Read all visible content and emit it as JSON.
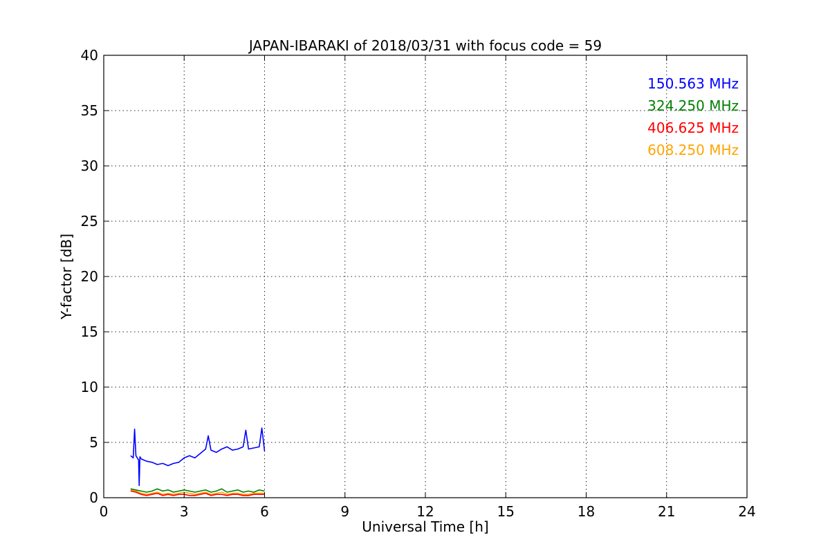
{
  "chart_data": {
    "type": "line",
    "title": "JAPAN-IBARAKI of 2018/03/31 with focus code = 59",
    "xlabel": "Universal Time [h]",
    "ylabel": "Y-factor [dB]",
    "xlim": [
      0,
      24
    ],
    "ylim": [
      0,
      40
    ],
    "xticks": [
      "0",
      "3",
      "6",
      "9",
      "12",
      "15",
      "18",
      "21",
      "24"
    ],
    "yticks": [
      "0",
      "5",
      "10",
      "15",
      "20",
      "25",
      "30",
      "35",
      "40"
    ],
    "grid": true,
    "legend_position": "top-right",
    "series": [
      {
        "name": "150.563 MHz",
        "color": "#0000ff",
        "x": [
          1.0,
          1.1,
          1.15,
          1.2,
          1.3,
          1.32,
          1.35,
          1.4,
          1.6,
          1.8,
          2.0,
          2.2,
          2.4,
          2.6,
          2.8,
          3.0,
          3.2,
          3.4,
          3.6,
          3.8,
          3.9,
          4.0,
          4.2,
          4.4,
          4.6,
          4.8,
          5.0,
          5.2,
          5.3,
          5.4,
          5.6,
          5.8,
          5.9,
          6.0
        ],
        "values": [
          3.8,
          3.6,
          6.2,
          3.8,
          3.4,
          1.1,
          3.7,
          3.5,
          3.3,
          3.2,
          3.0,
          3.1,
          2.9,
          3.1,
          3.2,
          3.6,
          3.8,
          3.6,
          4.0,
          4.4,
          5.6,
          4.3,
          4.1,
          4.4,
          4.6,
          4.3,
          4.4,
          4.6,
          6.1,
          4.4,
          4.5,
          4.6,
          6.3,
          4.2
        ]
      },
      {
        "name": "324.250 MHz",
        "color": "#008000",
        "x": [
          1.0,
          1.2,
          1.4,
          1.6,
          1.8,
          2.0,
          2.2,
          2.4,
          2.6,
          2.8,
          3.0,
          3.2,
          3.4,
          3.6,
          3.8,
          4.0,
          4.2,
          4.4,
          4.6,
          4.8,
          5.0,
          5.2,
          5.4,
          5.6,
          5.8,
          6.0
        ],
        "values": [
          0.8,
          0.7,
          0.6,
          0.5,
          0.6,
          0.8,
          0.6,
          0.7,
          0.5,
          0.6,
          0.7,
          0.6,
          0.5,
          0.6,
          0.7,
          0.5,
          0.6,
          0.8,
          0.5,
          0.6,
          0.7,
          0.5,
          0.6,
          0.5,
          0.7,
          0.6
        ]
      },
      {
        "name": "406.625 MHz",
        "color": "#ff0000",
        "x": [
          1.0,
          1.2,
          1.4,
          1.6,
          1.8,
          2.0,
          2.2,
          2.4,
          2.6,
          2.8,
          3.0,
          3.2,
          3.4,
          3.6,
          3.8,
          4.0,
          4.2,
          4.4,
          4.6,
          4.8,
          5.0,
          5.2,
          5.4,
          5.6,
          5.8,
          6.0
        ],
        "values": [
          0.6,
          0.5,
          0.3,
          0.2,
          0.3,
          0.4,
          0.2,
          0.3,
          0.2,
          0.3,
          0.3,
          0.2,
          0.2,
          0.3,
          0.4,
          0.2,
          0.3,
          0.3,
          0.2,
          0.3,
          0.3,
          0.2,
          0.2,
          0.3,
          0.3,
          0.3
        ]
      },
      {
        "name": "608.250 MHz",
        "color": "#ffa500",
        "x": [
          1.0,
          1.2,
          1.4,
          1.6,
          1.8,
          2.0,
          2.2,
          2.4,
          2.6,
          2.8,
          3.0,
          3.2,
          3.4,
          3.6,
          3.8,
          4.0,
          4.2,
          4.4,
          4.6,
          4.8,
          5.0,
          5.2,
          5.4,
          5.6,
          5.8,
          6.0
        ],
        "values": [
          0.7,
          0.6,
          0.4,
          0.3,
          0.4,
          0.5,
          0.3,
          0.4,
          0.3,
          0.4,
          0.5,
          0.4,
          0.3,
          0.4,
          0.5,
          0.3,
          0.4,
          0.5,
          0.3,
          0.4,
          0.4,
          0.3,
          0.3,
          0.4,
          0.4,
          0.4
        ]
      }
    ]
  }
}
